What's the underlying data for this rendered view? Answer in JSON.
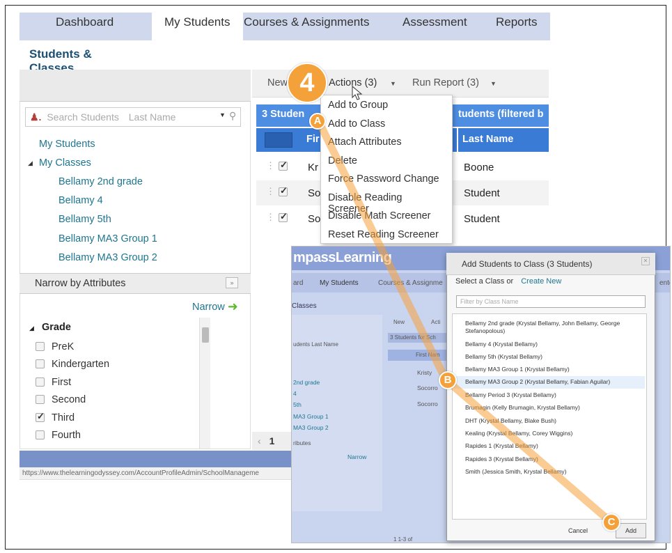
{
  "nav": {
    "tabs": [
      "Dashboard",
      "My Students",
      "Courses & Assignments",
      "Assessment",
      "Reports"
    ]
  },
  "page_title": "Students & Classes",
  "search": {
    "placeholder": "Search Students",
    "mode": "Last Name"
  },
  "tree": {
    "my_students": "My Students",
    "my_classes": "My Classes",
    "classes": [
      "Bellamy 2nd grade",
      "Bellamy 4",
      "Bellamy 5th",
      "Bellamy MA3 Group 1",
      "Bellamy MA3 Group 2"
    ]
  },
  "narrow": {
    "header": "Narrow by Attributes",
    "button": "Narrow"
  },
  "grade_filter": {
    "title": "Grade",
    "options": [
      {
        "label": "PreK",
        "checked": false
      },
      {
        "label": "Kindergarten",
        "checked": false
      },
      {
        "label": "First",
        "checked": false
      },
      {
        "label": "Second",
        "checked": false
      },
      {
        "label": "Third",
        "checked": true
      },
      {
        "label": "Fourth",
        "checked": false
      }
    ]
  },
  "status_url": "https://www.thelearningodyssey.com/AccountProfileAdmin/SchoolManageme",
  "toolbar": {
    "new": "New",
    "actions": "Actions (3)",
    "run_report": "Run Report (3)"
  },
  "grid": {
    "left_banner": "3 Studen",
    "right_banner": "tudents (filtered b",
    "col_first": "Fir",
    "col_last": "Last Name",
    "rows": [
      {
        "first": "Kr",
        "last": "Boone"
      },
      {
        "first": "So",
        "last": "Student"
      },
      {
        "first": "So",
        "last": "Student"
      }
    ],
    "pager": "1"
  },
  "actions_menu": [
    "Add to Group",
    "Add to Class",
    "Attach Attributes",
    "Delete",
    "Force Password Change",
    "Disable Reading Screener",
    "Disable Math Screener",
    "Reset Reading Screener"
  ],
  "inset": {
    "logo": "mpassLearning",
    "nav": [
      "ard",
      "My Students",
      "Courses & Assignme",
      "ente"
    ],
    "subtab": "Classes",
    "toolbar": [
      "New",
      "Acti"
    ],
    "search_hint": "udents   Last Name",
    "banner": "3 Students for Sch",
    "col_first": "First Nam",
    "rows": [
      "Kristy",
      "Socorro",
      "Socorro"
    ],
    "classes": [
      "2nd grade",
      "4",
      "5th",
      "MA3 Group 1",
      "MA3 Group 2"
    ],
    "attributes": "ributes",
    "narrow": "Narrow",
    "pager": "1   1-3 of"
  },
  "dialog": {
    "title": "Add Students to Class (3 Students)",
    "select_label": "Select a Class or",
    "create_new": "Create New",
    "filter_placeholder": "Filter by Class Name",
    "classes": [
      "Bellamy 2nd grade (Krystal Bellamy, John Bellamy, George Stefanopolous)",
      "Bellamy 4 (Krystal Bellamy)",
      "Bellamy 5th (Krystal Bellamy)",
      "Bellamy MA3 Group 1 (Krystal Bellamy)",
      "Bellamy MA3 Group 2 (Krystal Bellamy, Fabian Aguilar)",
      "Bellamy Period 3 (Krystal Bellamy)",
      "Brumagin (Kelly Brumagin, Krystal Bellamy)",
      "DHT (Krystal Bellamy, Blake Bush)",
      "Kealing (Krystal Bellamy, Corey Wiggins)",
      "Rapides 1 (Krystal Bellamy)",
      "Rapides 3 (Krystal Bellamy)",
      "Smith (Jessica Smith, Krystal Bellamy)"
    ],
    "cancel": "Cancel",
    "add": "Add"
  },
  "callouts": {
    "step": "4",
    "a": "A",
    "b": "B",
    "c": "C"
  },
  "colors": {
    "accent_orange": "#f5a13a",
    "grid_blue": "#3a7bd5",
    "link_teal": "#1d7690"
  }
}
